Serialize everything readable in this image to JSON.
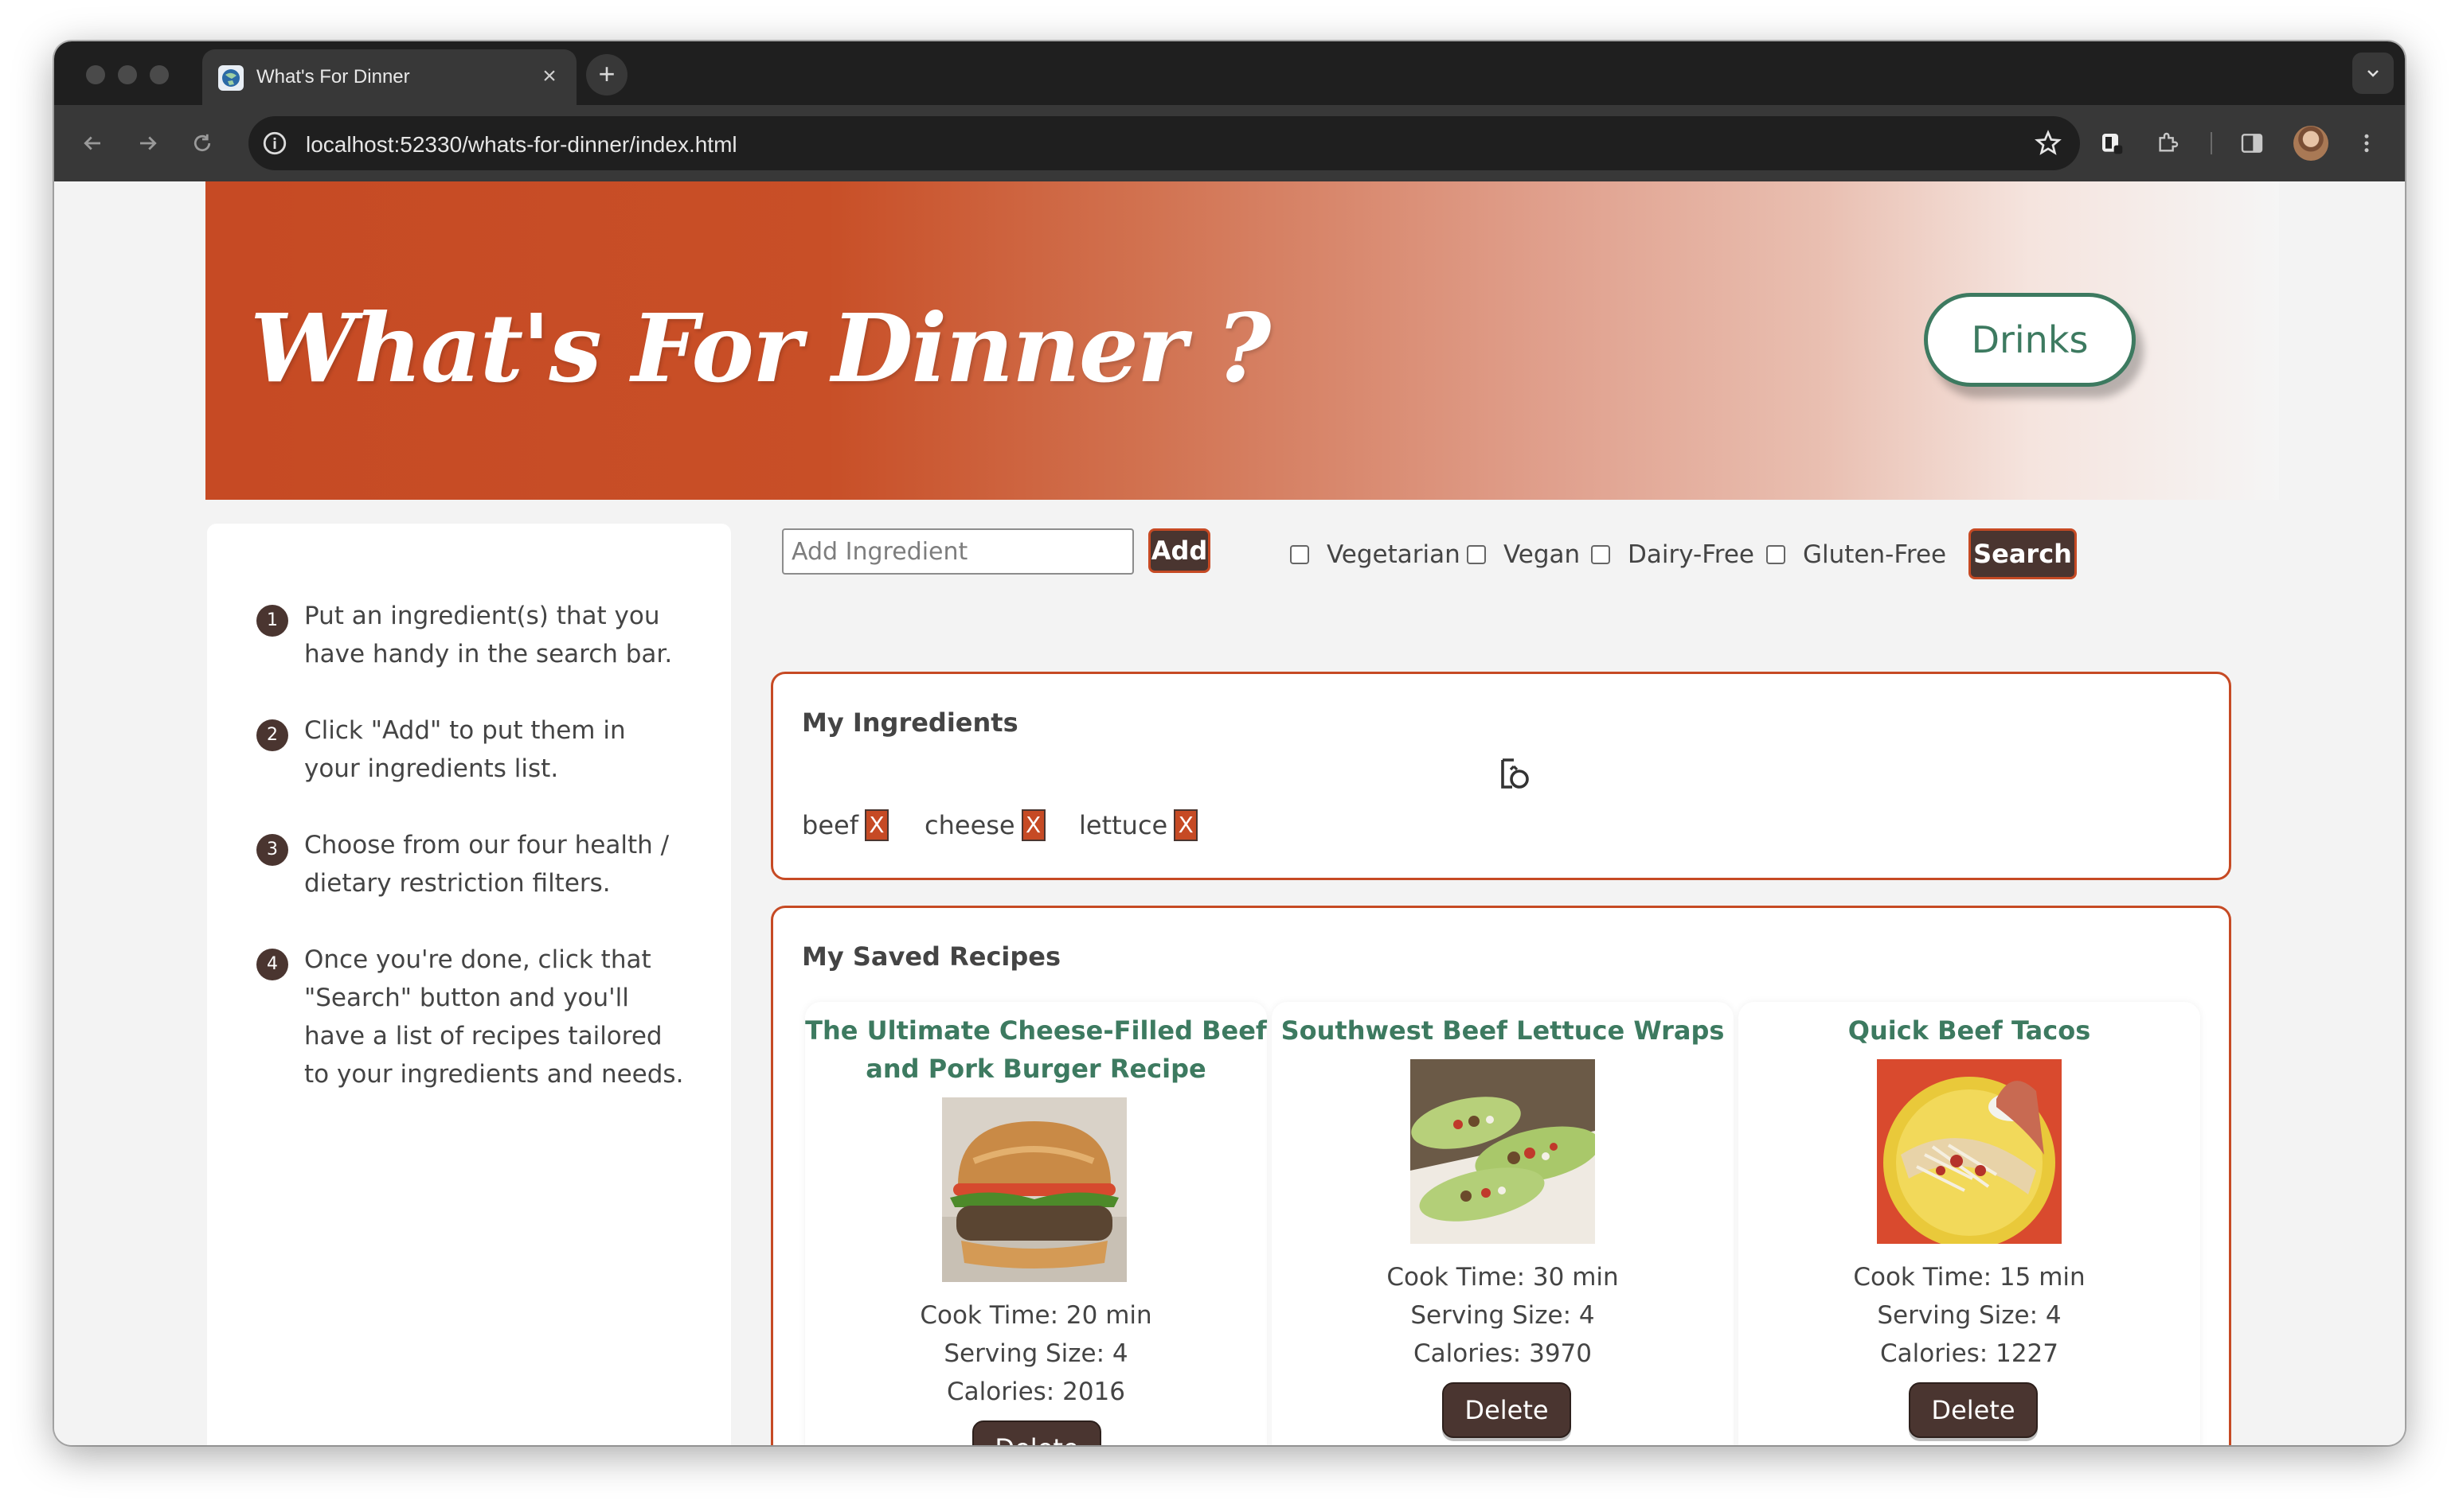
{
  "browser": {
    "tab_title": "What's For Dinner",
    "url": "localhost:52330/whats-for-dinner/index.html"
  },
  "header": {
    "title": "What's For Dinner ?",
    "drinks_label": "Drinks"
  },
  "instructions": [
    {
      "num": "1",
      "text": "Put an ingredient(s) that you have handy in the search bar."
    },
    {
      "num": "2",
      "text": "Click \"Add\" to put them in your ingredients list."
    },
    {
      "num": "3",
      "text": "Choose from our four health / dietary restriction filters."
    },
    {
      "num": "4",
      "text": "Once you're done, click that \"Search\" button and you'll have a list of recipes tailored to your ingredients and needs."
    }
  ],
  "search": {
    "placeholder": "Add Ingredient",
    "value": "",
    "add_label": "Add",
    "search_label": "Search",
    "filters": [
      {
        "label": "Vegetarian",
        "checked": false
      },
      {
        "label": "Vegan",
        "checked": false
      },
      {
        "label": "Dairy-Free",
        "checked": false
      },
      {
        "label": "Gluten-Free",
        "checked": false
      }
    ]
  },
  "my_ingredients": {
    "title": "My Ingredients",
    "remove_label": "X",
    "items": [
      "beef",
      "cheese",
      "lettuce"
    ]
  },
  "saved_recipes": {
    "title": "My Saved Recipes",
    "recipes": [
      {
        "title": "The Ultimate Cheese-Filled Beef and Pork Burger Recipe",
        "cook_time": "Cook Time: 20 min",
        "serving_size": "Serving Size: 4",
        "calories": "Calories: 2016",
        "delete_label": "Delete",
        "image": "burger-photo"
      },
      {
        "title": "Southwest Beef Lettuce Wraps",
        "cook_time": "Cook Time: 30 min",
        "serving_size": "Serving Size: 4",
        "calories": "Calories: 3970",
        "delete_label": "Delete",
        "image": "lettuce-wraps-photo"
      },
      {
        "title": "Quick Beef Tacos",
        "cook_time": "Cook Time: 15 min",
        "serving_size": "Serving Size: 4",
        "calories": "Calories: 1227",
        "delete_label": "Delete",
        "image": "tacos-photo"
      }
    ]
  },
  "colors": {
    "accent": "#c64a24",
    "brand_dark": "#4a3530",
    "green": "#3d7a60"
  }
}
